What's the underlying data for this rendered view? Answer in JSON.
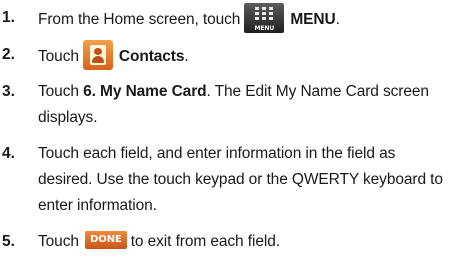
{
  "steps": [
    {
      "number": "1.",
      "before": "From the Home screen, touch",
      "icon_caption": "MENU",
      "after": "MENU",
      "end": "."
    },
    {
      "number": "2.",
      "before": "Touch",
      "after": "Contacts",
      "end": "."
    },
    {
      "number": "3.",
      "before": "Touch",
      "bold": "6. My Name Card",
      "line1_rest": ". The Edit My Name Card screen",
      "line2": "displays."
    },
    {
      "number": "4.",
      "line1": "Touch each field, and enter information in the field as",
      "line2": "desired. Use the touch keypad or the QWERTY keyboard to",
      "line3": "enter information."
    },
    {
      "number": "5.",
      "before": "Touch",
      "button_label": "DONE",
      "after": "to exit from each field."
    }
  ],
  "icons": {
    "menu": "menu-grid-icon",
    "contacts": "contacts-icon"
  }
}
